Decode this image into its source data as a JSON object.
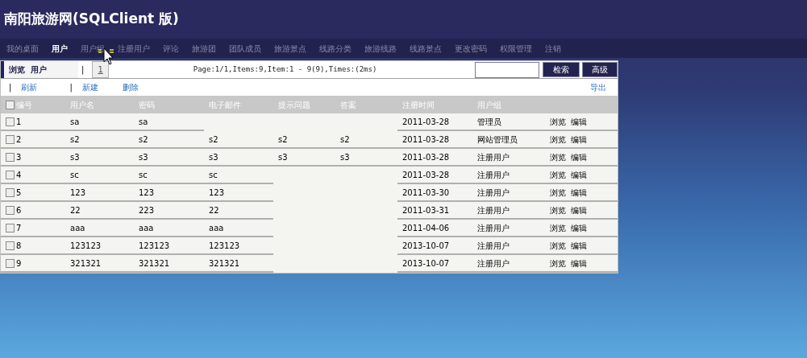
{
  "title": "南阳旅游网(SQLClient  版)",
  "nav": [
    {
      "label": "我的桌面",
      "selected": false
    },
    {
      "label": "用户",
      "selected": true
    },
    {
      "label": "用户组",
      "selected": false
    },
    {
      "label": "注册用户",
      "selected": false
    },
    {
      "label": "评论",
      "selected": false
    },
    {
      "label": "旅游团",
      "selected": false
    },
    {
      "label": "团队成员",
      "selected": false
    },
    {
      "label": "旅游景点",
      "selected": false
    },
    {
      "label": "线路分类",
      "selected": false
    },
    {
      "label": "旅游线路",
      "selected": false
    },
    {
      "label": "线路景点",
      "selected": false
    },
    {
      "label": "更改密码",
      "selected": false
    },
    {
      "label": "权限管理",
      "selected": false
    },
    {
      "label": "注销",
      "selected": false
    }
  ],
  "panel": {
    "heading": "浏览  用户",
    "separator": "|",
    "page": "1",
    "page_info": "Page:1/1,Items:9,Item:1 - 9(9),Times:(2ms)",
    "search_button": "检索",
    "advanced_button": "高级",
    "actions": [
      {
        "kind": "separator",
        "label": "|"
      },
      {
        "kind": "link",
        "label": "刷新"
      },
      {
        "kind": "separator",
        "label": "|"
      },
      {
        "kind": "link",
        "label": "新建"
      },
      {
        "kind": "link",
        "label": "删除"
      }
    ],
    "export": "导出"
  },
  "table": {
    "select_all_checked": false,
    "columns": [
      "编号",
      "用户名",
      "密码",
      "电子邮件",
      "提示问题",
      "答案",
      "注册时间",
      "用户组"
    ],
    "rows": [
      {
        "checked": false,
        "cells": [
          "1",
          "sa",
          "sa",
          null,
          null,
          null,
          "2011-03-28",
          "管理员"
        ],
        "actions": [
          "浏览",
          "编辑"
        ]
      },
      {
        "checked": false,
        "cells": [
          "2",
          "s2",
          "s2",
          "s2",
          "s2",
          "s2",
          "2011-03-28",
          "网站管理员"
        ],
        "actions": [
          "浏览",
          "编辑"
        ]
      },
      {
        "checked": false,
        "cells": [
          "3",
          "s3",
          "s3",
          "s3",
          "s3",
          "s3",
          "2011-03-28",
          "注册用户"
        ],
        "actions": [
          "浏览",
          "编辑"
        ]
      },
      {
        "checked": false,
        "cells": [
          "4",
          "sc",
          "sc",
          "sc",
          null,
          null,
          "2011-03-28",
          "注册用户"
        ],
        "actions": [
          "浏览",
          "编辑"
        ]
      },
      {
        "checked": false,
        "cells": [
          "5",
          "123",
          "123",
          "123",
          null,
          null,
          "2011-03-30",
          "注册用户"
        ],
        "actions": [
          "浏览",
          "编辑"
        ]
      },
      {
        "checked": false,
        "cells": [
          "6",
          "22",
          "223",
          "22",
          null,
          null,
          "2011-03-31",
          "注册用户"
        ],
        "actions": [
          "浏览",
          "编辑"
        ]
      },
      {
        "checked": false,
        "cells": [
          "7",
          "aaa",
          "aaa",
          "aaa",
          null,
          null,
          "2011-04-06",
          "注册用户"
        ],
        "actions": [
          "浏览",
          "编辑"
        ]
      },
      {
        "checked": false,
        "cells": [
          "8",
          "123123",
          "123123",
          "123123",
          null,
          null,
          "2013-10-07",
          "注册用户"
        ],
        "actions": [
          "浏览",
          "编辑"
        ]
      },
      {
        "checked": false,
        "cells": [
          "9",
          "321321",
          "321321",
          "321321",
          null,
          null,
          "2013-10-07",
          "注册用户"
        ],
        "actions": [
          "浏览",
          "编辑"
        ]
      }
    ]
  }
}
